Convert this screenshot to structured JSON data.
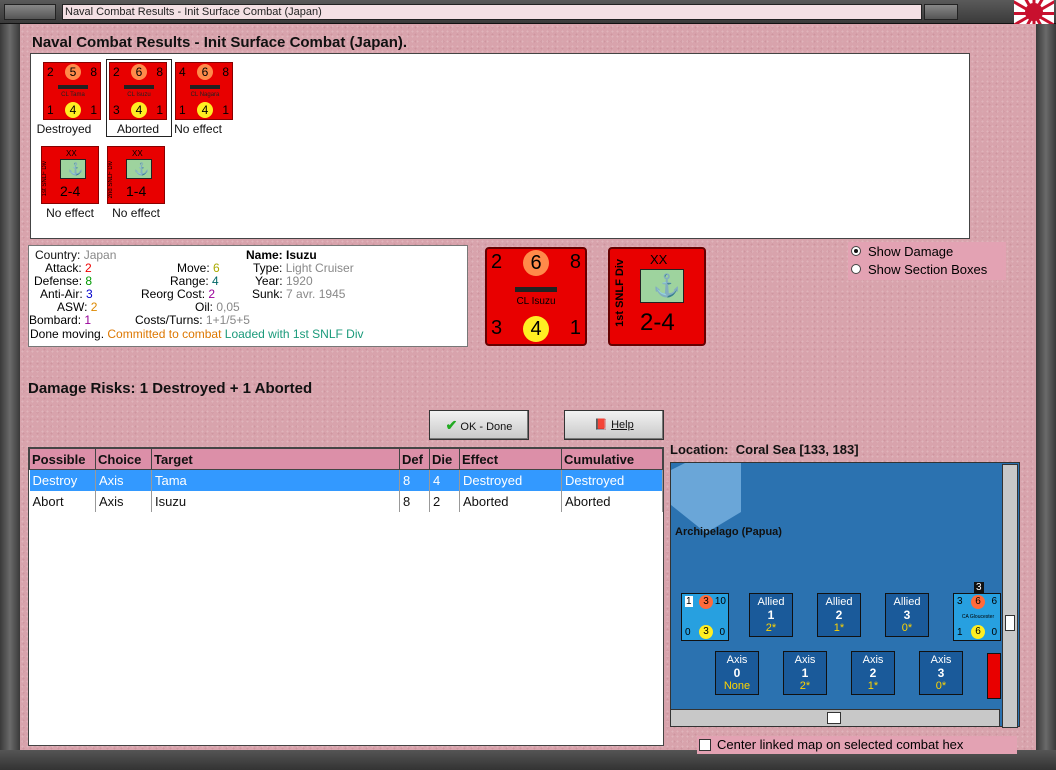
{
  "window": {
    "title": "Naval Combat Results - Init Surface Combat (Japan)"
  },
  "heading": "Naval Combat Results - Init Surface Combat (Japan).",
  "units": [
    {
      "top_left": "2",
      "top_center": "5",
      "top_right": "8",
      "name": "CL Tama",
      "bottom_left": "1",
      "bottom_center": "4",
      "bottom_right": "1",
      "status": "Destroyed"
    },
    {
      "top_left": "2",
      "top_center": "6",
      "top_right": "8",
      "name": "CL Isuzu",
      "bottom_left": "3",
      "bottom_center": "4",
      "bottom_right": "1",
      "status": "Aborted"
    },
    {
      "top_left": "4",
      "top_center": "6",
      "top_right": "8",
      "name": "CL Nagara",
      "bottom_left": "1",
      "bottom_center": "4",
      "bottom_right": "1",
      "status": "No effect"
    }
  ],
  "land_units": [
    {
      "size": "XX",
      "side_name": "1st SNLF Div",
      "value": "2-4",
      "status": "No effect"
    },
    {
      "size": "XX",
      "side_name": "2nd SNLF Div",
      "value": "1-4",
      "status": "No effect"
    }
  ],
  "info": {
    "country_label": "Country:",
    "country": "Japan",
    "attack_label": "Attack:",
    "attack": "2",
    "defense_label": "Defense:",
    "defense": "8",
    "antiair_label": "Anti-Air:",
    "antiair": "3",
    "asw_label": "ASW:",
    "asw": "2",
    "bombard_label": "Bombard:",
    "bombard": "1",
    "move_label": "Move:",
    "move": "6",
    "range_label": "Range:",
    "range": "4",
    "reorg_label": "Reorg Cost:",
    "reorg": "2",
    "oil_label": "Oil:",
    "oil": "0,05",
    "costs_label": "Costs/Turns:",
    "costs": "1+1/5+5",
    "name_label": "Name:",
    "name": "Isuzu",
    "type_label": "Type:",
    "type": "Light Cruiser",
    "year_label": "Year:",
    "year": "1920",
    "sunk_label": "Sunk:",
    "sunk": "7 avr. 1945",
    "done": "Done moving.",
    "committed": "Committed to combat",
    "loaded": "Loaded with 1st SNLF Div"
  },
  "big_ship": {
    "tl": "2",
    "tc": "6",
    "tr": "8",
    "name": "CL Isuzu",
    "bl": "3",
    "bc": "4",
    "br": "1"
  },
  "big_land": {
    "size": "XX",
    "side_name": "1st SNLF Div",
    "value": "2-4"
  },
  "options": {
    "show_damage": "Show Damage",
    "show_sections": "Show Section Boxes"
  },
  "damage_risks": "Damage Risks:  1 Destroyed + 1 Aborted",
  "buttons": {
    "ok": "OK - Done",
    "help": "Help"
  },
  "table": {
    "headers": [
      "Possible",
      "Choice",
      "Target",
      "Def",
      "Die",
      "Effect",
      "Cumulative"
    ],
    "rows": [
      [
        "Destroy",
        "Axis",
        "Tama",
        "8",
        "4",
        "Destroyed",
        "Destroyed"
      ],
      [
        "Abort",
        "Axis",
        "Isuzu",
        "8",
        "2",
        "Aborted",
        "Aborted"
      ]
    ]
  },
  "location": {
    "label": "Location:",
    "value": "Coral Sea [133, 183]"
  },
  "map": {
    "region": "Archipelago (Papua)",
    "allied_boxes": [
      {
        "side": "Allied",
        "num": "1",
        "val": "2*"
      },
      {
        "side": "Allied",
        "num": "2",
        "val": "1*"
      },
      {
        "side": "Allied",
        "num": "3",
        "val": "0*"
      }
    ],
    "axis_boxes": [
      {
        "side": "Axis",
        "num": "0",
        "val": "None"
      },
      {
        "side": "Axis",
        "num": "1",
        "val": "2*"
      },
      {
        "side": "Axis",
        "num": "2",
        "val": "1*"
      },
      {
        "side": "Axis",
        "num": "3",
        "val": "0*"
      }
    ],
    "left_unit": {
      "tl": "1",
      "tc": "3",
      "tr": "10",
      "bl": "0",
      "bc": "3",
      "br": "0"
    },
    "right_unit": {
      "stack": "3",
      "tl": "3",
      "tc": "6",
      "tr": "6",
      "name": "CA Gloucester",
      "bl": "1",
      "bc": "6",
      "br": "0"
    }
  },
  "center_map_label": "Center linked map on selected combat hex"
}
